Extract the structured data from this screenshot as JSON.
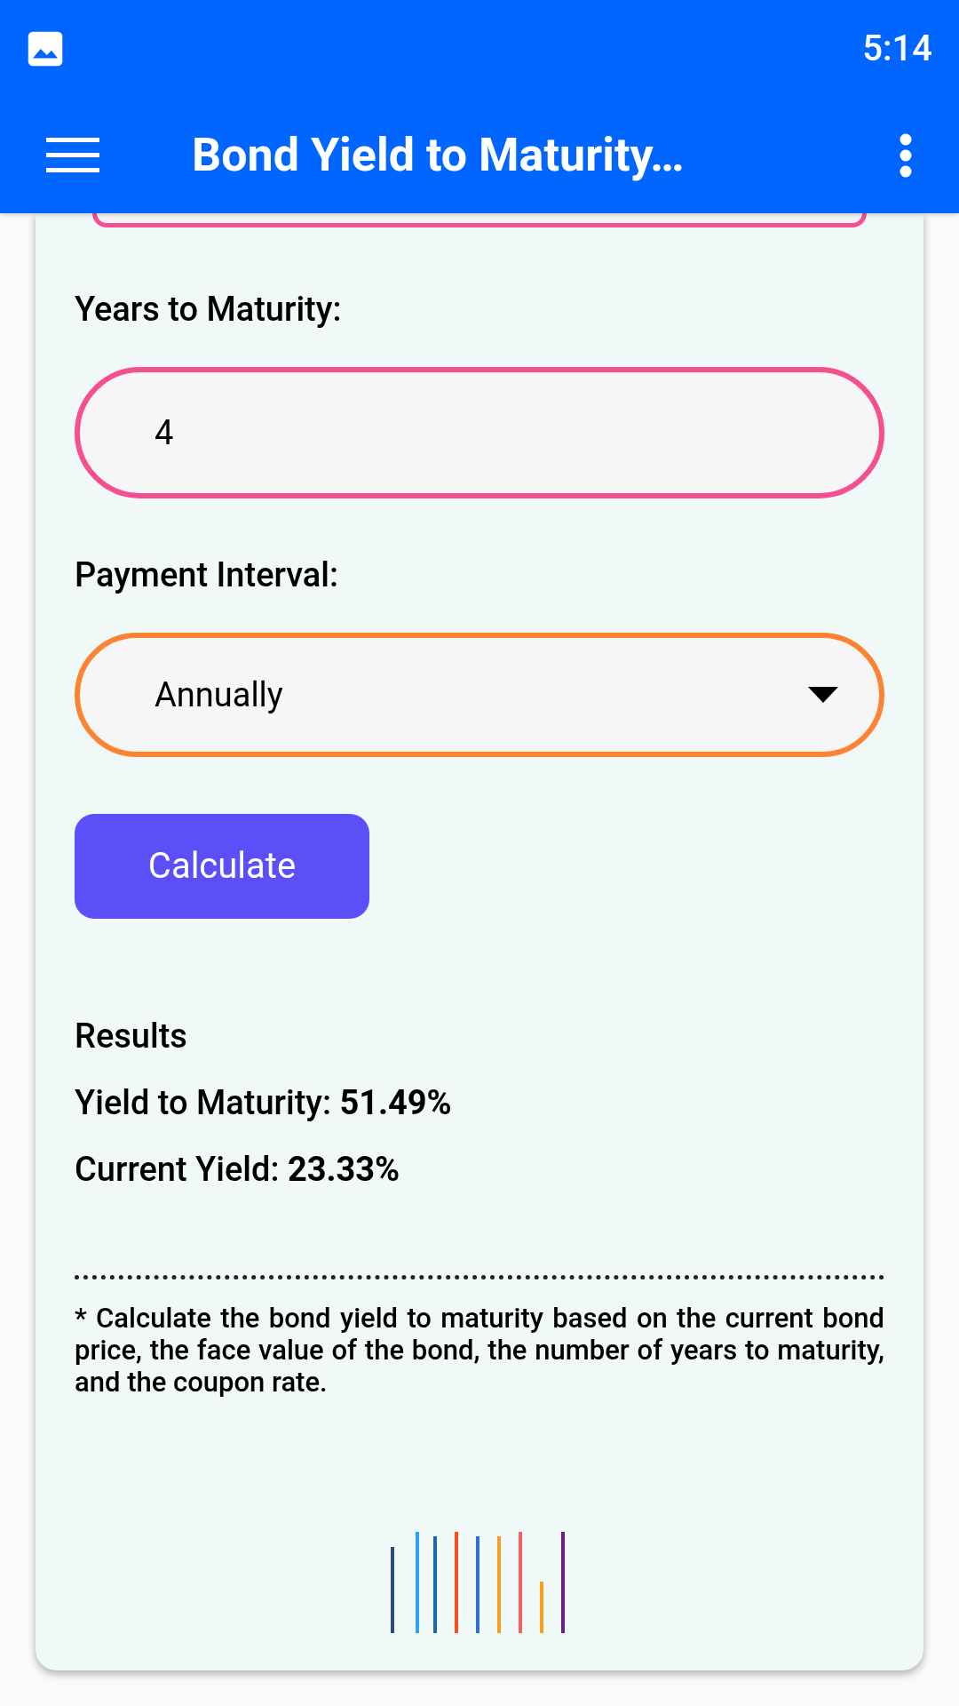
{
  "status_bar": {
    "time": "5:14"
  },
  "app_bar": {
    "title": "Bond Yield to Maturity…"
  },
  "form": {
    "years_label": "Years to Maturity:",
    "years_value": "4",
    "interval_label": "Payment Interval:",
    "interval_value": "Annually",
    "calculate_button": "Calculate"
  },
  "results": {
    "heading": "Results",
    "lines": [
      {
        "label": "Yield to Maturity:",
        "value": "51.49%"
      },
      {
        "label": "Current Yield:",
        "value": "23.33%"
      }
    ]
  },
  "footnote": "* Calculate the bond yield to maturity based on the current bond price, the face value of the bond, the number of years to maturity, and the coupon rate."
}
